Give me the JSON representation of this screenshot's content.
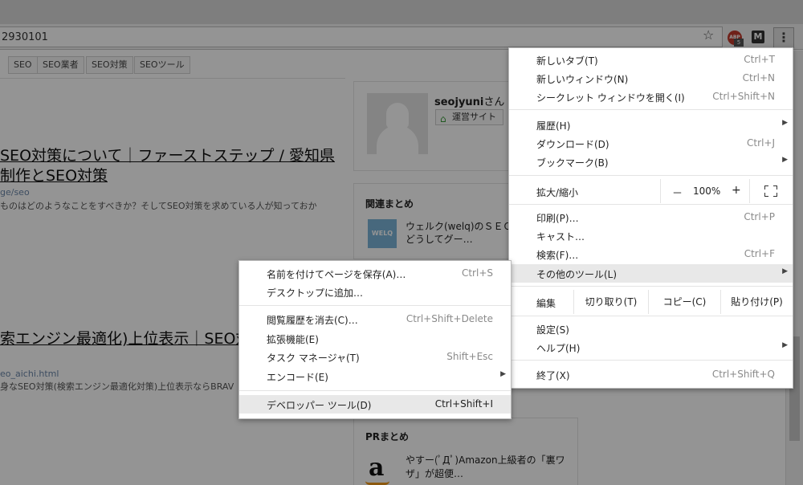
{
  "browser": {
    "url": "2930101",
    "menu_button_glyph": "⋮",
    "abp_label": "ABP",
    "abp_badge": "5",
    "m_label": "M"
  },
  "page": {
    "tags": [
      "SEO",
      "SEO業者",
      "SEO対策",
      "SEOツール"
    ],
    "articles": [
      {
        "title_line1": "SEO対策について｜ファーストステップ / 愛知県",
        "title_line2": "制作とSEO対策",
        "url": "ge/seo",
        "snippet": "ものはどのようなことをすべきか？そしてSEO対策を求めている人が知っておか"
      },
      {
        "title_line1": "索エンジン最適化)上位表示｜SEO対",
        "url": "eo_aichi.html",
        "snippet": "身なSEO対策(検索エンジン最適化対策)上位表示ならBRAV"
      }
    ],
    "profile": {
      "username": "seojyuni",
      "suffix": "さん",
      "site_button": "運営サイト"
    },
    "related": {
      "heading": "関連まとめ",
      "logo_text": "WELQ",
      "item_line1": "ウェルク(welq)のＳＥＯ対",
      "item_line2": "どうしてグー…"
    },
    "pr": {
      "heading": "PRまとめ",
      "logo_text": "a",
      "item_line1": "やすー(ﾟДﾟ)Amazon上級者の「裏ワ",
      "item_line2": "ザ」が超便…"
    }
  },
  "main_menu": {
    "items": [
      {
        "label": "新しいタブ(T)",
        "shortcut": "Ctrl+T"
      },
      {
        "label": "新しいウィンドウ(N)",
        "shortcut": "Ctrl+N"
      },
      {
        "label": "シークレット ウィンドウを開く(I)",
        "shortcut": "Ctrl+Shift+N"
      },
      {
        "label": "履歴(H)",
        "shortcut": ""
      },
      {
        "label": "ダウンロード(D)",
        "shortcut": "Ctrl+J"
      },
      {
        "label": "ブックマーク(B)",
        "shortcut": ""
      },
      {
        "label": "印刷(P)…",
        "shortcut": "Ctrl+P"
      },
      {
        "label": "キャスト…",
        "shortcut": ""
      },
      {
        "label": "検索(F)…",
        "shortcut": "Ctrl+F"
      },
      {
        "label": "その他のツール(L)",
        "shortcut": ""
      },
      {
        "label": "設定(S)",
        "shortcut": ""
      },
      {
        "label": "ヘルプ(H)",
        "shortcut": ""
      },
      {
        "label": "終了(X)",
        "shortcut": "Ctrl+Shift+Q"
      }
    ],
    "zoom": {
      "label": "拡大/縮小",
      "minus": "－",
      "value": "100%",
      "plus": "+"
    },
    "edit": {
      "label": "編集",
      "cut": "切り取り(T)",
      "copy": "コピー(C)",
      "paste": "貼り付け(P)"
    }
  },
  "sub_menu": {
    "items": [
      {
        "label": "名前を付けてページを保存(A)…",
        "shortcut": "Ctrl+S"
      },
      {
        "label": "デスクトップに追加…",
        "shortcut": ""
      },
      {
        "label": "閲覧履歴を消去(C)…",
        "shortcut": "Ctrl+Shift+Delete"
      },
      {
        "label": "拡張機能(E)",
        "shortcut": ""
      },
      {
        "label": "タスク マネージャ(T)",
        "shortcut": "Shift+Esc"
      },
      {
        "label": "エンコード(E)",
        "shortcut": ""
      },
      {
        "label": "デベロッパー ツール(D)",
        "shortcut": "Ctrl+Shift+I"
      }
    ]
  },
  "colors": {
    "dim_overlay": "#000000",
    "highlight": "#e8e8e8",
    "shortcut_text": "#8a8a8a"
  }
}
